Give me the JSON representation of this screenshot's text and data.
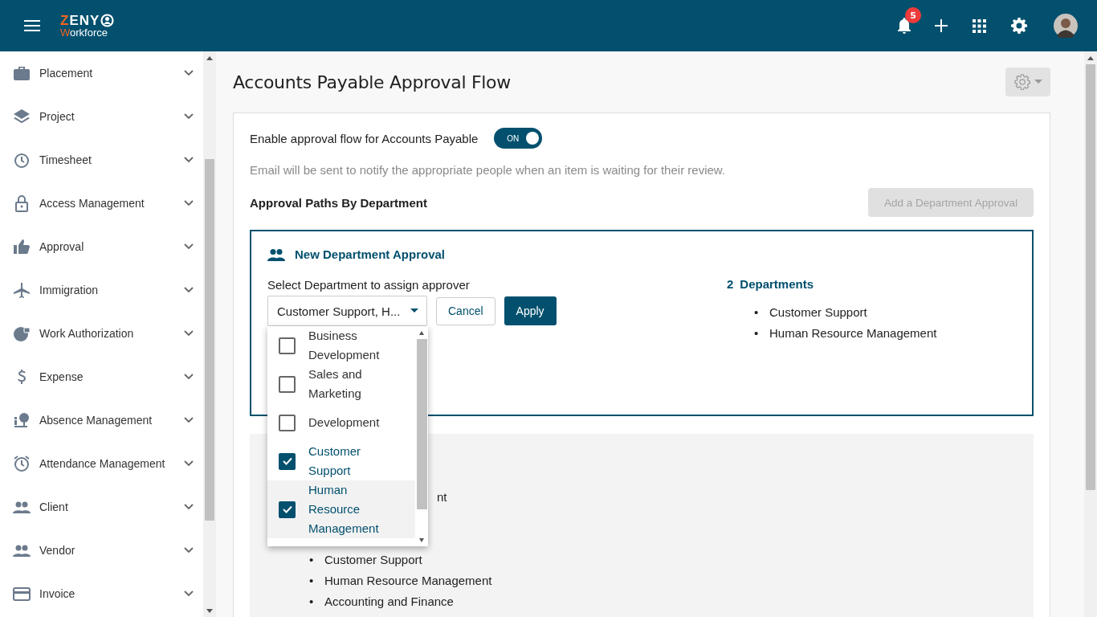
{
  "header": {
    "logo_initial": "Z",
    "logo_rest": "ENY",
    "logo_sub_initial": "W",
    "logo_sub_rest": "orkforce",
    "notification_count": "5"
  },
  "sidebar": {
    "items": [
      {
        "label": "Placement"
      },
      {
        "label": "Project"
      },
      {
        "label": "Timesheet"
      },
      {
        "label": "Access Management"
      },
      {
        "label": "Approval"
      },
      {
        "label": "Immigration"
      },
      {
        "label": "Work Authorization"
      },
      {
        "label": "Expense"
      },
      {
        "label": "Absence Management"
      },
      {
        "label": "Attendance Management"
      },
      {
        "label": "Client"
      },
      {
        "label": "Vendor"
      },
      {
        "label": "Invoice"
      }
    ]
  },
  "page": {
    "title": "Accounts Payable Approval Flow"
  },
  "settings": {
    "enable_label": "Enable approval flow for Accounts Payable",
    "toggle": {
      "label": "ON",
      "on": true
    },
    "note": "Email will be sent to notify the appropriate people when an item is waiting for their review.",
    "section_title": "Approval Paths By Department",
    "add_button": {
      "label": "Add a Department Approval",
      "disabled": true
    }
  },
  "new_approval": {
    "title": "New Department Approval",
    "select_label": "Select Department to assign approver",
    "select_value": "Customer Support, H...",
    "cancel": "Cancel",
    "apply": "Apply",
    "count": "2",
    "count_label": "Departments",
    "marker": "•",
    "selected": [
      "Customer Support",
      "Human Resource Management"
    ],
    "options": [
      {
        "label": "Business Development",
        "checked": false,
        "highlighted": false
      },
      {
        "label": "Sales and Marketing",
        "checked": false,
        "highlighted": false
      },
      {
        "label": "Development",
        "checked": false,
        "highlighted": false
      },
      {
        "label": "Customer Support",
        "checked": true,
        "highlighted": false
      },
      {
        "label": "Human Resource Management",
        "checked": true,
        "highlighted": true
      }
    ]
  },
  "existing": {
    "fragment": "nt",
    "marker": "•",
    "items": [
      "Customer Support",
      "Human Resource Management",
      "Accounting and Finance"
    ]
  }
}
